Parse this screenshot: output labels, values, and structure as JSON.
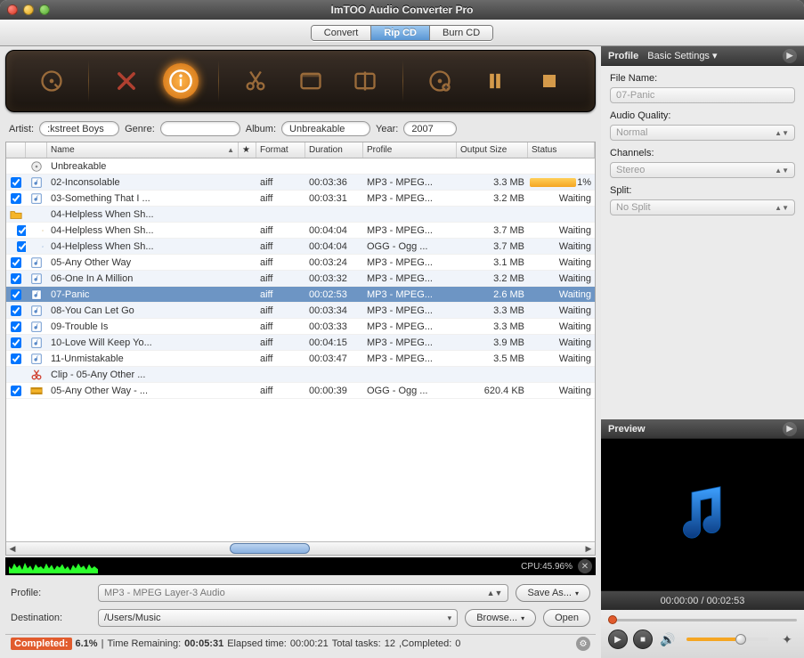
{
  "window_title": "ImTOO Audio Converter Pro",
  "main_tabs": {
    "convert": "Convert",
    "rip": "Rip CD",
    "burn": "Burn CD",
    "active": "rip"
  },
  "meta": {
    "artist_label": "Artist:",
    "artist": ":kstreet Boys",
    "genre_label": "Genre:",
    "genre": "",
    "album_label": "Album:",
    "album": "Unbreakable",
    "year_label": "Year:",
    "year": "2007"
  },
  "columns": {
    "name": "Name",
    "star": "★",
    "format": "Format",
    "duration": "Duration",
    "profile": "Profile",
    "output_size": "Output Size",
    "status": "Status"
  },
  "rows": [
    {
      "indent": 0,
      "chk": null,
      "icon": "cd",
      "name": "Unbreakable",
      "fmt": "",
      "dur": "",
      "prof": "",
      "size": "",
      "stat": ""
    },
    {
      "indent": 0,
      "chk": true,
      "icon": "audio",
      "name": "02-Inconsolable",
      "fmt": "aiff",
      "dur": "00:03:36",
      "prof": "MP3 - MPEG...",
      "size": "3.3 MB",
      "stat": "69.1%",
      "progress": 69.1
    },
    {
      "indent": 0,
      "chk": true,
      "icon": "audio",
      "name": "03-Something That I ...",
      "fmt": "aiff",
      "dur": "00:03:31",
      "prof": "MP3 - MPEG...",
      "size": "3.2 MB",
      "stat": "Waiting"
    },
    {
      "indent": 0,
      "chk": null,
      "icon": "folder",
      "name": "04-Helpless When Sh...",
      "fmt": "",
      "dur": "",
      "prof": "",
      "size": "",
      "stat": ""
    },
    {
      "indent": 1,
      "chk": true,
      "icon": "doc",
      "name": "04-Helpless When Sh...",
      "fmt": "aiff",
      "dur": "00:04:04",
      "prof": "MP3 - MPEG...",
      "size": "3.7 MB",
      "stat": "Waiting"
    },
    {
      "indent": 1,
      "chk": true,
      "icon": "audio",
      "name": "04-Helpless When Sh...",
      "fmt": "aiff",
      "dur": "00:04:04",
      "prof": "OGG - Ogg ...",
      "size": "3.7 MB",
      "stat": "Waiting"
    },
    {
      "indent": 0,
      "chk": true,
      "icon": "audio",
      "name": "05-Any Other Way",
      "fmt": "aiff",
      "dur": "00:03:24",
      "prof": "MP3 - MPEG...",
      "size": "3.1 MB",
      "stat": "Waiting"
    },
    {
      "indent": 0,
      "chk": true,
      "icon": "audio",
      "name": "06-One In A Million",
      "fmt": "aiff",
      "dur": "00:03:32",
      "prof": "MP3 - MPEG...",
      "size": "3.2 MB",
      "stat": "Waiting"
    },
    {
      "indent": 0,
      "chk": true,
      "icon": "audio",
      "name": "07-Panic",
      "fmt": "aiff",
      "dur": "00:02:53",
      "prof": "MP3 - MPEG...",
      "size": "2.6 MB",
      "stat": "Waiting",
      "selected": true
    },
    {
      "indent": 0,
      "chk": true,
      "icon": "audio",
      "name": "08-You Can Let Go",
      "fmt": "aiff",
      "dur": "00:03:34",
      "prof": "MP3 - MPEG...",
      "size": "3.3 MB",
      "stat": "Waiting"
    },
    {
      "indent": 0,
      "chk": true,
      "icon": "audio",
      "name": "09-Trouble Is",
      "fmt": "aiff",
      "dur": "00:03:33",
      "prof": "MP3 - MPEG...",
      "size": "3.3 MB",
      "stat": "Waiting"
    },
    {
      "indent": 0,
      "chk": true,
      "icon": "audio",
      "name": "10-Love Will Keep Yo...",
      "fmt": "aiff",
      "dur": "00:04:15",
      "prof": "MP3 - MPEG...",
      "size": "3.9 MB",
      "stat": "Waiting"
    },
    {
      "indent": 0,
      "chk": true,
      "icon": "audio",
      "name": "11-Unmistakable",
      "fmt": "aiff",
      "dur": "00:03:47",
      "prof": "MP3 - MPEG...",
      "size": "3.5 MB",
      "stat": "Waiting"
    },
    {
      "indent": 0,
      "chk": null,
      "icon": "clip",
      "name": "Clip - 05-Any Other ...",
      "fmt": "",
      "dur": "",
      "prof": "",
      "size": "",
      "stat": ""
    },
    {
      "indent": 0,
      "chk": true,
      "icon": "segment",
      "name": "05-Any Other Way - ...",
      "fmt": "aiff",
      "dur": "00:00:39",
      "prof": "OGG - Ogg ...",
      "size": "620.4 KB",
      "stat": "Waiting"
    }
  ],
  "cpu": {
    "label": "CPU:",
    "value": "45.96%"
  },
  "profile_row": {
    "label": "Profile:",
    "value": "MP3 - MPEG Layer-3 Audio",
    "save_as": "Save As..."
  },
  "dest_row": {
    "label": "Destination:",
    "value": "/Users/Music",
    "browse": "Browse...",
    "open": "Open"
  },
  "status": {
    "completed_label": "Completed:",
    "completed_pct": "6.1%",
    "time_remaining_label": "Time Remaining:",
    "time_remaining": "00:05:31",
    "elapsed_label": "Elapsed time:",
    "elapsed": "00:00:21",
    "total_tasks_label": "Total tasks:",
    "total_tasks": "12",
    "completed_count_label": ",Completed:",
    "completed_count": "0"
  },
  "profile_panel": {
    "title": "Profile",
    "settings": "Basic Settings",
    "file_name_label": "File Name:",
    "file_name": "07-Panic",
    "audio_quality_label": "Audio Quality:",
    "audio_quality": "Normal",
    "channels_label": "Channels:",
    "channels": "Stereo",
    "split_label": "Split:",
    "split": "No Split"
  },
  "preview": {
    "title": "Preview",
    "time": "00:00:00 / 00:02:53"
  }
}
